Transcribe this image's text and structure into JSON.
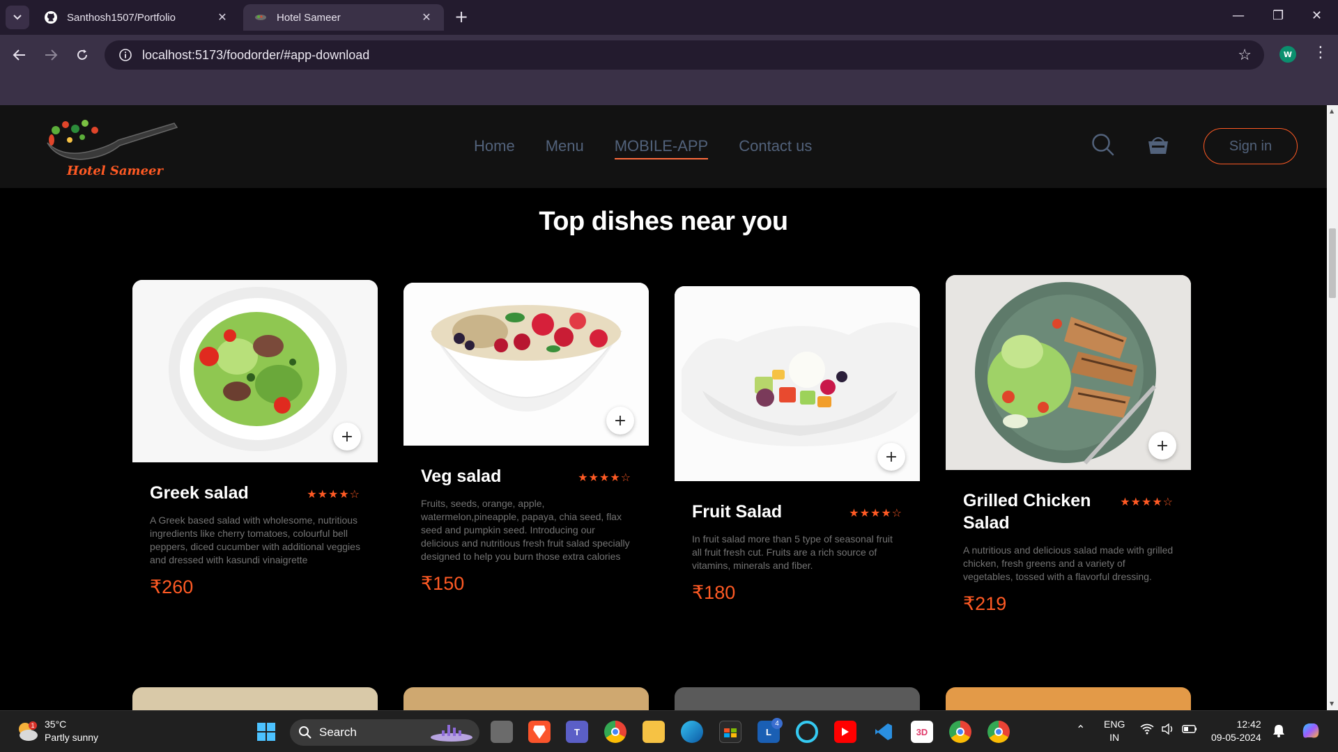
{
  "browser": {
    "tabs": [
      {
        "title": "Santhosh1507/Portfolio",
        "favicon": "github-icon"
      },
      {
        "title": "Hotel Sameer",
        "favicon": "site-favicon"
      }
    ],
    "url": "localhost:5173/foodorder/#app-download",
    "profile_initial": "W"
  },
  "site": {
    "logo_text": "Hotel Sameer",
    "nav": [
      {
        "label": "Home"
      },
      {
        "label": "Menu"
      },
      {
        "label": "MOBILE-APP"
      },
      {
        "label": "Contact us"
      }
    ],
    "active_nav": "MOBILE-APP",
    "signin_label": "Sign in",
    "section_title": "Top dishes near you",
    "accent_color": "#ff5a24",
    "nav_text_color": "#52627b"
  },
  "dishes": [
    {
      "name": "Greek salad",
      "rating": 4,
      "stars": "★★★★☆",
      "description": "A Greek based salad with wholesome, nutritious ingredients like cherry tomatoes, colourful bell peppers, diced cucumber with additional veggies and dressed with kasundi vinaigrette",
      "price": "₹260"
    },
    {
      "name": "Veg salad",
      "rating": 4,
      "stars": "★★★★☆",
      "description": "Fruits, seeds, orange, apple, watermelon,pineapple, papaya, chia seed, flax seed and pumpkin seed. Introducing our delicious and nutritious fresh fruit salad specially designed to help you burn those extra calories",
      "price": "₹150"
    },
    {
      "name": "Fruit Salad",
      "rating": 4,
      "stars": "★★★★☆",
      "description": "In fruit salad more than 5 type of seasonal fruit all fruit fresh cut. Fruits are a rich source of vitamins, minerals and fiber.",
      "price": "₹180"
    },
    {
      "name": "Grilled Chicken Salad",
      "rating": 4,
      "stars": "★★★★☆",
      "description": "A nutritious and delicious salad made with grilled chicken, fresh greens and a variety of vegetables, tossed with a flavorful dressing.",
      "price": "₹219"
    }
  ],
  "taskbar": {
    "weather_temp": "35°C",
    "weather_desc": "Partly sunny",
    "weather_badge": "1",
    "search_label": "Search",
    "lang_line1": "ENG",
    "lang_line2": "IN",
    "time": "12:42",
    "date": "09-05-2024",
    "outlook_badge": "4"
  }
}
